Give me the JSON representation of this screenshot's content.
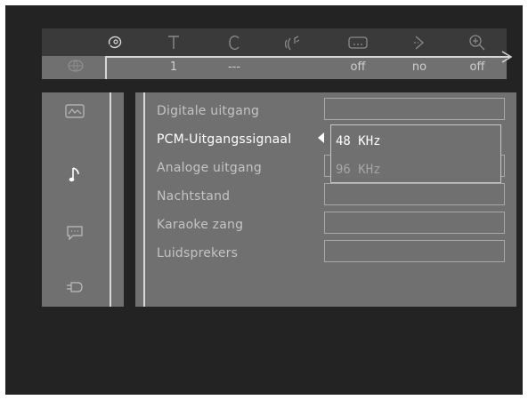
{
  "topbar": {
    "icons": [
      {
        "name": "disc-icon"
      },
      {
        "name": "title-icon"
      },
      {
        "name": "chapter-icon"
      },
      {
        "name": "audio-icon"
      },
      {
        "name": "subtitle-icon"
      },
      {
        "name": "angle-icon"
      },
      {
        "name": "zoom-icon"
      }
    ],
    "values": {
      "title": "1",
      "chapter": "---",
      "subtitle": "off",
      "angle": "no",
      "zoom": "off"
    }
  },
  "sidebar": {
    "items": [
      {
        "name": "picture-icon"
      },
      {
        "name": "music-note-icon"
      },
      {
        "name": "speech-bubble-icon"
      },
      {
        "name": "plug-icon"
      }
    ],
    "active_index": 1
  },
  "settings": {
    "rows": [
      {
        "label": "Digitale uitgang"
      },
      {
        "label": "PCM-Uitgangssignaal"
      },
      {
        "label": "Analoge uitgang"
      },
      {
        "label": "Nachtstand"
      },
      {
        "label": "Karaoke zang"
      },
      {
        "label": "Luidsprekers"
      }
    ],
    "active_index": 1
  },
  "dropdown": {
    "options": [
      "48 KHz",
      "96 KHz"
    ],
    "selected_index": 0
  },
  "colors": {
    "screen_bg": "#232323",
    "panel_bg": "#707070",
    "highlight_text": "#ffffff"
  }
}
